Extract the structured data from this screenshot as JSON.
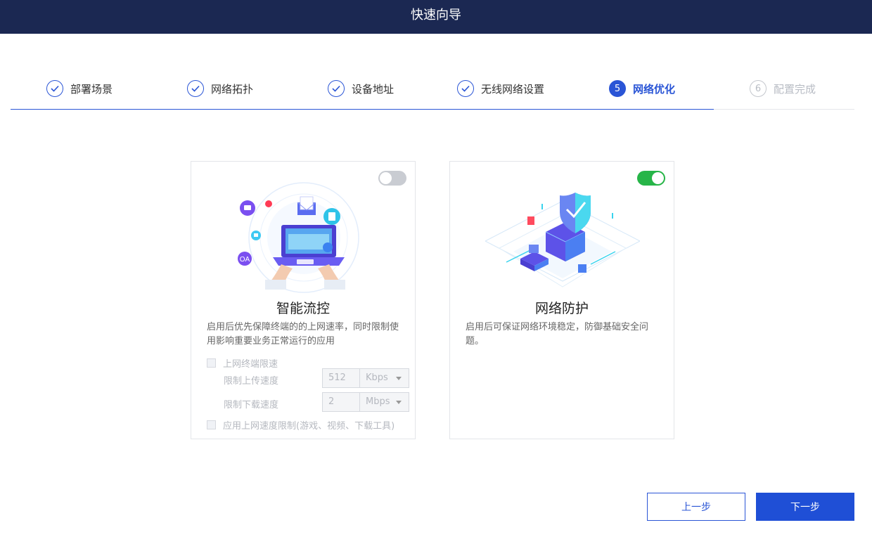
{
  "header": {
    "title": "快速向导"
  },
  "steps": [
    {
      "number": "1",
      "label": "部署场景",
      "state": "done"
    },
    {
      "number": "2",
      "label": "网络拓扑",
      "state": "done"
    },
    {
      "number": "3",
      "label": "设备地址",
      "state": "done"
    },
    {
      "number": "4",
      "label": "无线网络设置",
      "state": "done"
    },
    {
      "number": "5",
      "label": "网络优化",
      "state": "active"
    },
    {
      "number": "6",
      "label": "配置完成",
      "state": "pending"
    }
  ],
  "cards": {
    "flow_control": {
      "title": "智能流控",
      "description": "启用后优先保障终端的的上网速率，同时限制使用影响重要业务正常运行的应用",
      "enabled": false,
      "illustration_icons": [
        "laptop-icon",
        "mail-icon",
        "oa-icon",
        "document-icon",
        "chat-icon"
      ],
      "illustration_text": "OA",
      "terminal_limit": {
        "label": "上网终端限速",
        "checked": false,
        "upload": {
          "label": "限制上传速度",
          "value": "512",
          "unit": "Kbps"
        },
        "download": {
          "label": "限制下载速度",
          "value": "2",
          "unit": "Mbps"
        }
      },
      "app_limit": {
        "label": "应用上网速度限制(游戏、视频、下载工具)",
        "checked": false
      }
    },
    "protection": {
      "title": "网络防护",
      "description": "启用后可保证网络环境稳定，防御基础安全问题。",
      "enabled": true,
      "illustration_icons": [
        "shield-icon",
        "server-icon",
        "lock-icon"
      ]
    }
  },
  "buttons": {
    "prev": "上一步",
    "next": "下一步"
  },
  "colors": {
    "primary": "#2a55d6",
    "header_bg": "#1b2852",
    "toggle_on": "#27b548",
    "toggle_off": "#c9ccd2"
  }
}
